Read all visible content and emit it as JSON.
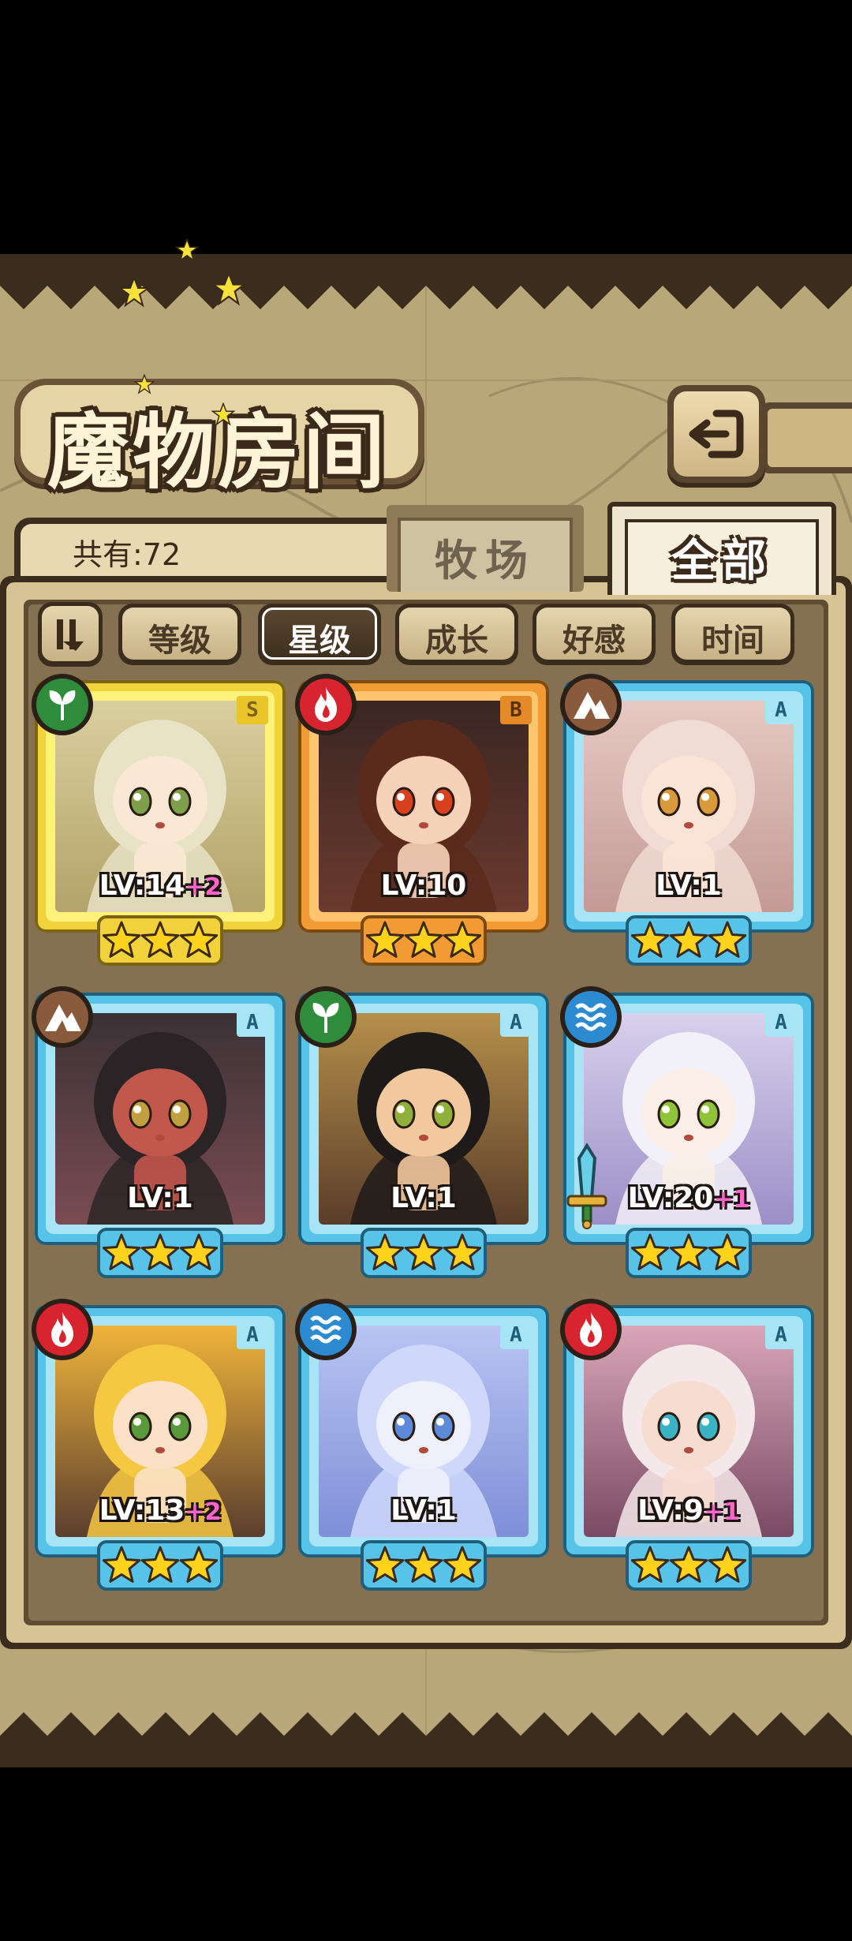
{
  "screen": {
    "title": "魔物房间",
    "count_label": "共有:72",
    "main_tabs": [
      {
        "label": "牧场",
        "active": false
      },
      {
        "label": "全部",
        "active": true
      }
    ],
    "sort_buttons": [
      {
        "label": "等级",
        "active": false
      },
      {
        "label": "星级",
        "active": true
      },
      {
        "label": "成长",
        "active": false
      },
      {
        "label": "好感",
        "active": false
      },
      {
        "label": "时间",
        "active": false
      }
    ]
  },
  "colors": {
    "background": "#b9a77a",
    "panel": "#857152",
    "gold_frame": "#f2d23a",
    "orange_frame": "#f29a34",
    "blue_frame": "#58c3e8",
    "fire": "#d8242e",
    "wind": "#2f8c3a",
    "earth": "#8a5a3c",
    "water": "#2c8ad0",
    "bonus_text": "#ff66cc"
  },
  "monsters": [
    {
      "element": "wind-icon",
      "rank": "S",
      "level": "LV:14",
      "bonus": "+2",
      "stars": 3
    },
    {
      "element": "fire-icon",
      "rank": "B",
      "level": "LV:10",
      "bonus": "",
      "stars": 3
    },
    {
      "element": "earth-icon",
      "rank": "A",
      "level": "LV:1",
      "bonus": "",
      "stars": 3
    },
    {
      "element": "earth-icon",
      "rank": "A",
      "level": "LV:1",
      "bonus": "",
      "stars": 3
    },
    {
      "element": "wind-icon",
      "rank": "A",
      "level": "LV:1",
      "bonus": "",
      "stars": 3
    },
    {
      "element": "water-icon",
      "rank": "A",
      "level": "LV:20",
      "bonus": "+1",
      "stars": 3,
      "equipped": "sword-icon"
    },
    {
      "element": "fire-icon",
      "rank": "A",
      "level": "LV:13",
      "bonus": "+2",
      "stars": 3
    },
    {
      "element": "water-icon",
      "rank": "A",
      "level": "LV:1",
      "bonus": "",
      "stars": 3
    },
    {
      "element": "fire-icon",
      "rank": "A",
      "level": "LV:9",
      "bonus": "+1",
      "stars": 3
    }
  ]
}
